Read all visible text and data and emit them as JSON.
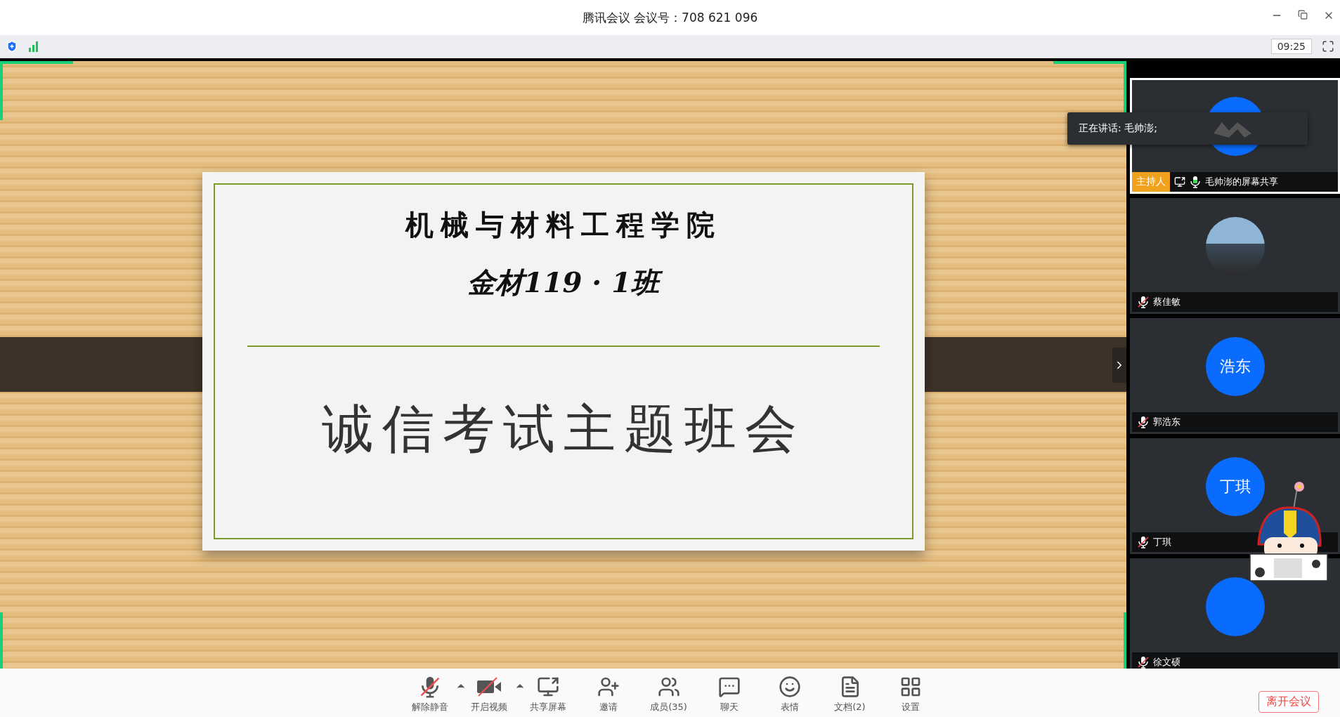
{
  "window": {
    "title": "腾讯会议 会议号：708 621 096"
  },
  "top_bar": {
    "time": "09:25"
  },
  "slide": {
    "school": "机械与材料工程学院",
    "class_name": "金材119 · 1班",
    "topic": "诚信考试主题班会"
  },
  "speaking_tooltip": "正在讲话: 毛帅澎;",
  "participants": [
    {
      "name": "毛帅澎的屏幕共享",
      "kind": "blank",
      "host_badge": "主持人",
      "sharing": true,
      "muted": false,
      "selected": true
    },
    {
      "name": "蔡佳敏",
      "kind": "photo",
      "sharing": false,
      "muted": true,
      "selected": false
    },
    {
      "name": "郭浩东",
      "kind": "initials",
      "initials": "浩东",
      "sharing": false,
      "muted": true,
      "selected": false
    },
    {
      "name": "丁琪",
      "kind": "initials",
      "initials": "丁琪",
      "sharing": false,
      "muted": true,
      "selected": false
    },
    {
      "name": "徐文硕",
      "kind": "blank",
      "sharing": false,
      "muted": true,
      "selected": false
    }
  ],
  "toolbar": [
    {
      "kind": "mic-off",
      "label": "解除静音",
      "caret": true
    },
    {
      "kind": "video-off",
      "label": "开启视频",
      "caret": true
    },
    {
      "kind": "share",
      "label": "共享屏幕",
      "caret": false
    },
    {
      "kind": "invite",
      "label": "邀请",
      "caret": false
    },
    {
      "kind": "members",
      "label": "成员(35)",
      "caret": false
    },
    {
      "kind": "chat",
      "label": "聊天",
      "caret": false
    },
    {
      "kind": "emoji",
      "label": "表情",
      "caret": false
    },
    {
      "kind": "doc",
      "label": "文档(2)",
      "caret": false
    },
    {
      "kind": "settings",
      "label": "设置",
      "caret": false
    }
  ],
  "leave_button": "离开会议"
}
